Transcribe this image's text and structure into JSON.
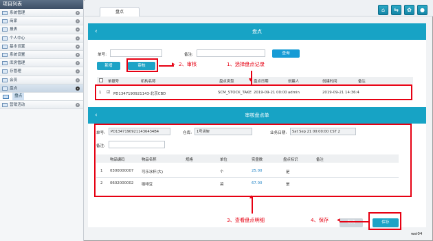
{
  "sidebar": {
    "title": "项目列表",
    "items": [
      {
        "label": "系统管理"
      },
      {
        "label": "商家"
      },
      {
        "label": "报表"
      },
      {
        "label": "个人中心"
      },
      {
        "label": "基本设置"
      },
      {
        "label": "系统设置"
      },
      {
        "label": "库房管理"
      },
      {
        "label": "存管理"
      },
      {
        "label": "会员"
      },
      {
        "label": "盘点"
      }
    ],
    "sub_item": "盘点",
    "last_item": "营销活动"
  },
  "topbar": {
    "tab_label": "盘点",
    "icons": [
      "home-icon",
      "share-icon",
      "settings-icon",
      "user-icon"
    ]
  },
  "panel1": {
    "title": "盘点",
    "filters": {
      "doc_no_label": "单号:",
      "remark_label": "备注:",
      "query_button": "查询"
    },
    "buttons": {
      "add": "新增",
      "audit": "审核"
    },
    "columns": [
      "单据号",
      "机构名称",
      "盘点类型",
      "盘点日期",
      "创建人",
      "创建时间",
      "备注"
    ],
    "row": {
      "index": "1",
      "checkbox": "☑",
      "doc_no": "PD1347190921143-北京CBD",
      "type": "SCM_STOCK_TAKE",
      "date": "2019-09-21 00:00",
      "creator": "admin",
      "created": "2019-09-21 14:36:4"
    }
  },
  "panel2": {
    "title": "审核盘点单",
    "doc_no_label": "单号:",
    "doc_no_value": "PD13471909211436434B4",
    "warehouse_label": "仓库:",
    "warehouse_value": "1号货架",
    "date_label": "业务日期:",
    "date_value": "Sat Sep 21 00:00:00 CST 2",
    "remark_label": "备注:",
    "columns": [
      "物品编码",
      "物品名称",
      "规格",
      "单位",
      "实盘数",
      "盘点标识",
      "备注"
    ],
    "rows": [
      {
        "index": "1",
        "code": "0300000007",
        "name": "可乐冰杯(大)",
        "unit": "个",
        "qty": "25.00",
        "flag": "是"
      },
      {
        "index": "2",
        "code": "0602000002",
        "name": "咖啡豆",
        "unit": "袋",
        "qty": "67.00",
        "flag": "是"
      }
    ],
    "cancel_button": "取消",
    "save_button": "保存"
  },
  "annotations": {
    "step1": "1、选择盘点记录",
    "step2": "2、审核",
    "step3": "3、查看盘点明细",
    "step4": "4、保存"
  },
  "watermark": "wei04"
}
